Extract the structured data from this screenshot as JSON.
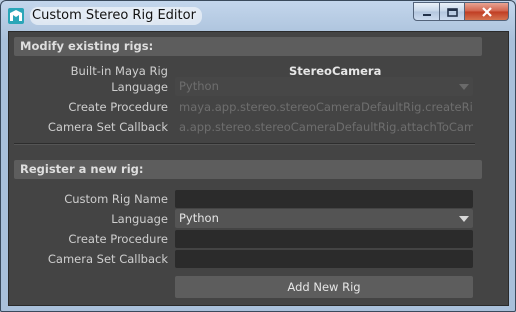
{
  "window": {
    "title": "Custom Stereo Rig Editor",
    "icon": "maya-app-icon"
  },
  "controls": {
    "minimize": "minimize-icon",
    "maximize": "maximize-icon",
    "close": "close-icon"
  },
  "modify_section": {
    "header": "Modify existing rigs:",
    "builtin_label": "Built-in Maya Rig",
    "builtin_value": "StereoCamera",
    "language_label": "Language",
    "language_value": "Python",
    "create_proc_label": "Create Procedure",
    "create_proc_value": "maya.app.stereo.stereoCameraDefaultRig.createRig",
    "callback_label": "Camera Set Callback",
    "callback_value": "a.app.stereo.stereoCameraDefaultRig.attachToCameraSet"
  },
  "register_section": {
    "header": "Register a new rig:",
    "rig_name_label": "Custom Rig Name",
    "rig_name_value": "",
    "language_label": "Language",
    "language_value": "Python",
    "create_proc_label": "Create Procedure",
    "create_proc_value": "",
    "callback_label": "Camera Set Callback",
    "callback_value": "",
    "add_button": "Add New Rig"
  },
  "colors": {
    "panel": "#444444",
    "header": "#5d5d5d",
    "field": "#2b2b2b",
    "close_button": "#c03c22"
  }
}
